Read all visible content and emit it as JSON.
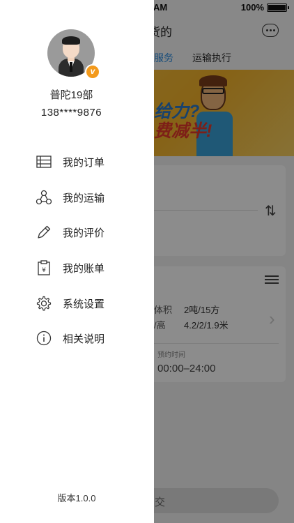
{
  "status_bar": {
    "time": "AM",
    "battery": "100%"
  },
  "background": {
    "nav_title": "货的",
    "tabs": [
      {
        "label": "服务"
      },
      {
        "label": "运输执行"
      }
    ],
    "banner": {
      "line1": "给力?",
      "line2": "费减半!"
    },
    "specs": [
      {
        "label": "体积",
        "value": "2吨/15方"
      },
      {
        "label": "/高",
        "value": "4.2/2/1.9米"
      }
    ],
    "time_label": "预约时间",
    "time_value": "00:00–24:00",
    "bottom_button": "交"
  },
  "drawer": {
    "user": {
      "name": "普陀19部",
      "phone": "138****9876",
      "badge": "v"
    },
    "menu": [
      {
        "label": "我的订单",
        "icon": "list-icon"
      },
      {
        "label": "我的运输",
        "icon": "network-icon"
      },
      {
        "label": "我的评价",
        "icon": "pencil-icon"
      },
      {
        "label": "我的账单",
        "icon": "bill-icon"
      },
      {
        "label": "系统设置",
        "icon": "gear-icon"
      },
      {
        "label": "相关说明",
        "icon": "info-icon"
      }
    ],
    "version": "版本1.0.0"
  },
  "colors": {
    "accent": "#2a8de0",
    "badge": "#f39a1c",
    "overlay": "rgba(0,0,0,0.45)"
  }
}
